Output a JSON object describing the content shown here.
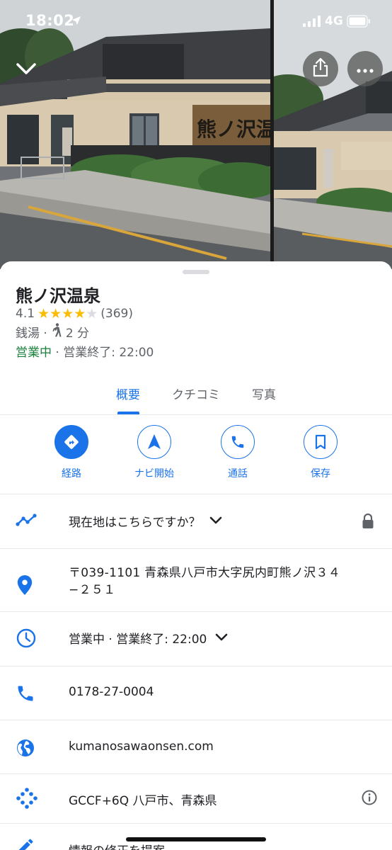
{
  "status_bar": {
    "time": "18:02",
    "network": "4G"
  },
  "place": {
    "name": "熊ノ沢温泉",
    "rating": "4.1",
    "rating_stars": 4.1,
    "review_count": "(369)",
    "category": "銭湯 ·",
    "walk_time": "2 分",
    "open_status": "営業中",
    "hours_summary": " · 営業終了: 22:00"
  },
  "tabs": [
    {
      "label": "概要",
      "active": true
    },
    {
      "label": "クチコミ",
      "active": false
    },
    {
      "label": "写真",
      "active": false
    }
  ],
  "actions": [
    {
      "label": "経路",
      "icon": "directions-icon"
    },
    {
      "label": "ナビ開始",
      "icon": "navigation-arrow-icon"
    },
    {
      "label": "通話",
      "icon": "phone-icon"
    },
    {
      "label": "保存",
      "icon": "bookmark-icon"
    }
  ],
  "details": {
    "location_prompt": "現在地はこちらですか？",
    "address": "〒039-1101 青森県八戸市大字尻内町熊ノ沢３４−２５１",
    "hours": "営業中 · 営業終了: 22:00",
    "phone": "0178-27-0004",
    "website": "kumanosawaonsen.com",
    "plus_code": "GCCF+6Q 八戸市、青森県",
    "suggest_edit": "情報の修正を提案"
  },
  "photo_sign_text": "熊ノ沢温",
  "colors": {
    "accent": "#1a73e8",
    "open_green": "#188038",
    "star": "#fbbc04",
    "secondary_text": "#5f6368",
    "divider": "#e8eaed"
  }
}
